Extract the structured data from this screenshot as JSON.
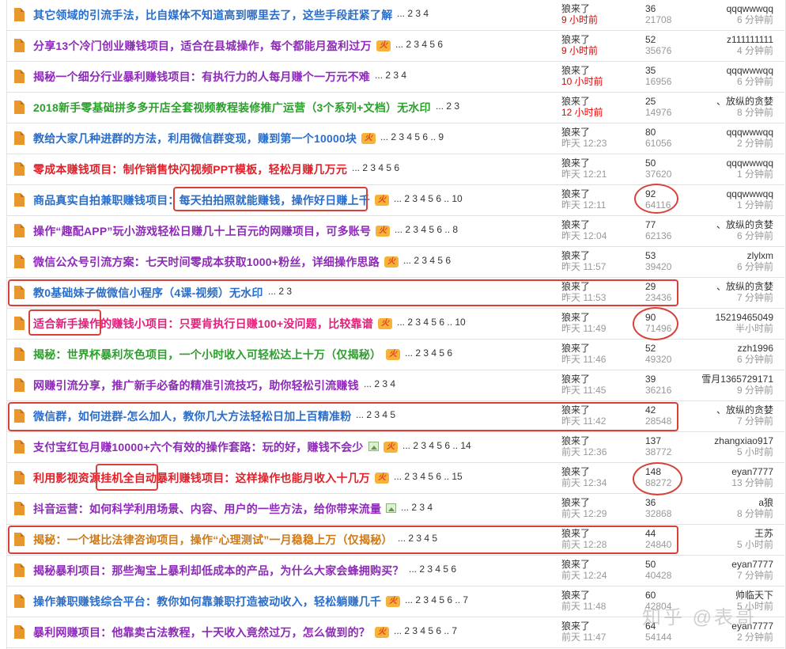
{
  "colors": {
    "accent_annotation": "#d8413a",
    "new_time": "#e60000",
    "file_icon": "#e8962e"
  },
  "threads": [
    {
      "title": "其它领域的引流手法，比自媒体不知道高到哪里去了，这些手段赶紧了解",
      "color": "blue",
      "hot": false,
      "img": false,
      "pages": "... 2 3 4",
      "author": "狼来了",
      "posted": "9 小时前",
      "posted_new": true,
      "replies": "36",
      "views": "21708",
      "last_user": "qqqwwwqq",
      "last_time": "6 分钟前"
    },
    {
      "title": "分享13个冷门创业赚钱项目，适合在县城操作，每个都能月盈利过万",
      "color": "purple",
      "hot": true,
      "img": false,
      "pages": "... 2 3 4 5 6",
      "author": "狼来了",
      "posted": "9 小时前",
      "posted_new": true,
      "replies": "52",
      "views": "35676",
      "last_user": "z111111111",
      "last_time": "4 分钟前"
    },
    {
      "title": "揭秘一个细分行业暴利赚钱项目：有执行力的人每月赚个一万元不难",
      "color": "purple",
      "hot": false,
      "img": false,
      "pages": "... 2 3 4",
      "author": "狼来了",
      "posted": "10 小时前",
      "posted_new": true,
      "replies": "35",
      "views": "16956",
      "last_user": "qqqwwwqq",
      "last_time": "6 分钟前"
    },
    {
      "title": "2018新手零基础拼多多开店全套视频教程装修推广运营（3个系列+文档）无水印",
      "color": "green",
      "hot": false,
      "img": false,
      "pages": "... 2 3",
      "author": "狼来了",
      "posted": "12 小时前",
      "posted_new": true,
      "replies": "25",
      "views": "14976",
      "last_user": "、放纵的贪婪",
      "last_time": "8 分钟前"
    },
    {
      "title": "教给大家几种进群的方法，利用微信群变现，赚到第一个10000块",
      "color": "blue",
      "hot": true,
      "img": false,
      "pages": "... 2 3 4 5 6 .. 9",
      "author": "狼来了",
      "posted": "昨天 12:23",
      "posted_new": false,
      "replies": "80",
      "views": "61056",
      "last_user": "qqqwwwqq",
      "last_time": "2 分钟前"
    },
    {
      "title": "零成本赚钱项目：制作销售快闪视频PPT模板，轻松月赚几万元",
      "color": "red",
      "hot": false,
      "img": false,
      "pages": "... 2 3 4 5 6",
      "author": "狼来了",
      "posted": "昨天 12:21",
      "posted_new": false,
      "replies": "50",
      "views": "37620",
      "last_user": "qqqwwwqq",
      "last_time": "1 分钟前"
    },
    {
      "title": "商品真实自拍兼职赚钱项目：每天拍拍照就能赚钱，操作好日赚上千",
      "color": "blue",
      "hot": true,
      "img": false,
      "pages": "... 2 3 4 5 6 .. 10",
      "author": "狼来了",
      "posted": "昨天 12:11",
      "posted_new": false,
      "replies": "92",
      "views": "64116",
      "last_user": "qqqwwwqq",
      "last_time": "1 分钟前"
    },
    {
      "title": "操作“趣配APP”玩小游戏轻松日赚几十上百元的网赚项目，可多账号",
      "color": "purple",
      "hot": true,
      "img": false,
      "pages": "... 2 3 4 5 6 .. 8",
      "author": "狼来了",
      "posted": "昨天 12:04",
      "posted_new": false,
      "replies": "77",
      "views": "62136",
      "last_user": "、放纵的贪婪",
      "last_time": "6 分钟前"
    },
    {
      "title": "微信公众号引流方案：七天时间零成本获取1000+粉丝，详细操作思路",
      "color": "purple",
      "hot": true,
      "img": false,
      "pages": "... 2 3 4 5 6",
      "author": "狼来了",
      "posted": "昨天 11:57",
      "posted_new": false,
      "replies": "53",
      "views": "39420",
      "last_user": "zlylxm",
      "last_time": "6 分钟前"
    },
    {
      "title": "教0基础妹子做微信小程序（4课-视频）无水印",
      "color": "blue",
      "hot": false,
      "img": false,
      "pages": "... 2 3",
      "author": "狼来了",
      "posted": "昨天 11:53",
      "posted_new": false,
      "replies": "29",
      "views": "23436",
      "last_user": "、放纵的贪婪",
      "last_time": "7 分钟前"
    },
    {
      "title": "适合新手操作的赚钱小项目：只要肯执行日赚100+没问题，比较靠谱",
      "color": "pink",
      "hot": true,
      "img": false,
      "pages": "... 2 3 4 5 6 .. 10",
      "author": "狼来了",
      "posted": "昨天 11:49",
      "posted_new": false,
      "replies": "90",
      "views": "71496",
      "last_user": "15219465049",
      "last_time": "半小时前"
    },
    {
      "title": "揭秘：世界杯暴利灰色项目，一个小时收入可轻松达上十万（仅揭秘）",
      "color": "green",
      "hot": true,
      "img": false,
      "pages": "... 2 3 4 5 6",
      "author": "狼来了",
      "posted": "昨天 11:46",
      "posted_new": false,
      "replies": "52",
      "views": "49320",
      "last_user": "zzh1996",
      "last_time": "6 分钟前"
    },
    {
      "title": "网赚引流分享，推广新手必备的精准引流技巧，助你轻松引流赚钱",
      "color": "purple",
      "hot": false,
      "img": false,
      "pages": "... 2 3 4",
      "author": "狼来了",
      "posted": "昨天 11:45",
      "posted_new": false,
      "replies": "39",
      "views": "36216",
      "last_user": "雪月1365729171",
      "last_time": "9 分钟前"
    },
    {
      "title": "微信群，如何进群-怎么加人，教你几大方法轻松日加上百精准粉",
      "color": "blue",
      "hot": false,
      "img": false,
      "pages": "... 2 3 4 5",
      "author": "狼来了",
      "posted": "昨天 11:42",
      "posted_new": false,
      "replies": "42",
      "views": "28548",
      "last_user": "、放纵的贪婪",
      "last_time": "7 分钟前"
    },
    {
      "title": "支付宝红包月赚10000+六个有效的操作套路：玩的好，赚钱不会少",
      "color": "purple",
      "hot": true,
      "img": true,
      "pages": "... 2 3 4 5 6 .. 14",
      "author": "狼来了",
      "posted": "前天 12:36",
      "posted_new": false,
      "replies": "137",
      "views": "38772",
      "last_user": "zhangxiao917",
      "last_time": "5 小时前"
    },
    {
      "title": "利用影视资源挂机全自动暴利赚钱项目：这样操作也能月收入十几万",
      "color": "red",
      "hot": true,
      "img": false,
      "pages": "... 2 3 4 5 6 .. 15",
      "author": "狼来了",
      "posted": "前天 12:34",
      "posted_new": false,
      "replies": "148",
      "views": "88272",
      "last_user": "eyan7777",
      "last_time": "13 分钟前"
    },
    {
      "title": "抖音运营：如何科学利用场景、内容、用户的一些方法，给你带来流量",
      "color": "purple",
      "hot": false,
      "img": true,
      "pages": "... 2 3 4",
      "author": "狼来了",
      "posted": "前天 12:29",
      "posted_new": false,
      "replies": "36",
      "views": "32868",
      "last_user": "a狼",
      "last_time": "8 分钟前"
    },
    {
      "title": "揭秘：一个堪比法律咨询项目，操作“心理测试”一月稳稳上万（仅揭秘）",
      "color": "orange",
      "hot": false,
      "img": false,
      "pages": "... 2 3 4 5",
      "author": "狼来了",
      "posted": "前天 12:28",
      "posted_new": false,
      "replies": "44",
      "views": "24840",
      "last_user": "王苏",
      "last_time": "5 小时前"
    },
    {
      "title": "揭秘暴利项目：那些淘宝上暴利却低成本的产品，为什么大家会蜂拥购买？",
      "color": "purple",
      "hot": false,
      "img": false,
      "pages": "... 2 3 4 5 6",
      "author": "狼来了",
      "posted": "前天 12:24",
      "posted_new": false,
      "replies": "50",
      "views": "40428",
      "last_user": "eyan7777",
      "last_time": "7 分钟前"
    },
    {
      "title": "操作兼职赚钱综合平台：教你如何靠兼职打造被动收入，轻松躺赚几千",
      "color": "blue",
      "hot": true,
      "img": false,
      "pages": "... 2 3 4 5 6 .. 7",
      "author": "狼来了",
      "posted": "前天 11:48",
      "posted_new": false,
      "replies": "60",
      "views": "42804",
      "last_user": "帅临天下",
      "last_time": "5 小时前"
    },
    {
      "title": "暴利网赚项目：他靠卖古法教程，十天收入竟然过万，怎么做到的？",
      "color": "purple",
      "hot": true,
      "img": false,
      "pages": "... 2 3 4 5 6 .. 7",
      "author": "狼来了",
      "posted": "前天 11:47",
      "posted_new": false,
      "replies": "64",
      "views": "54144",
      "last_user": "eyan7777",
      "last_time": "2 分钟前"
    }
  ],
  "hot_badge_text": "火",
  "watermark": "知乎 @表哥"
}
